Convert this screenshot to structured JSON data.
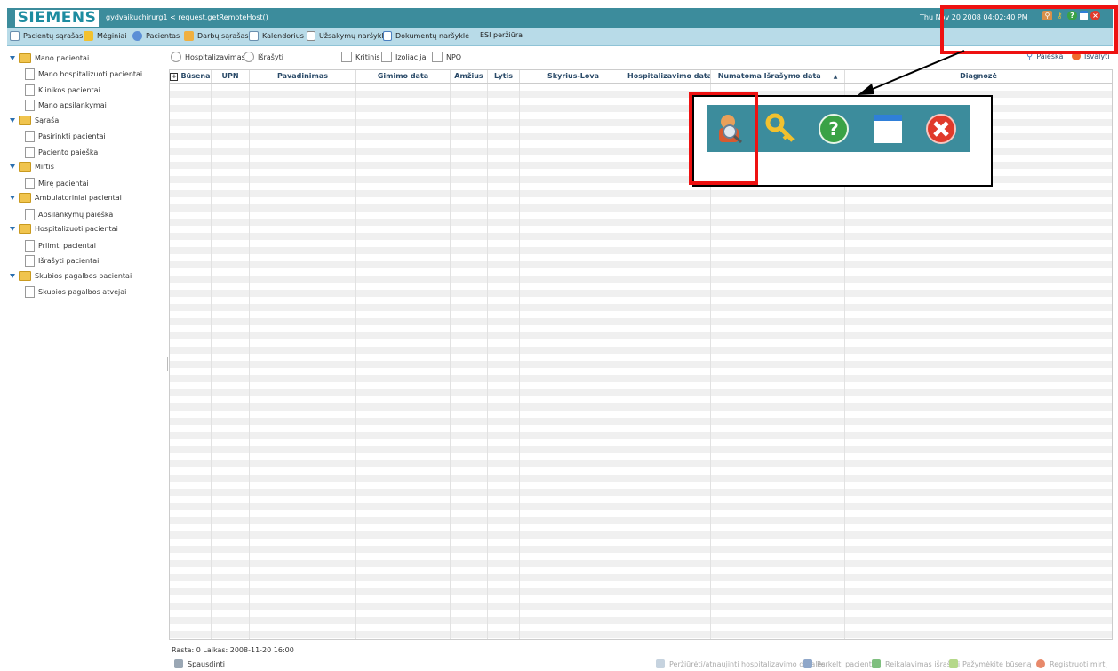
{
  "header": {
    "logo": "SIEMENS",
    "user": "gydvaikuchirurg1  < request.getRemoteHost()",
    "datetime": "Thu Nov 20 2008 04:02:40 PM",
    "icons": [
      "patient-search-icon",
      "key-icon",
      "help-icon",
      "window-icon",
      "close-icon"
    ]
  },
  "menu": {
    "items": [
      {
        "label": "Pacientų sąrašas",
        "icon": "grid-list-icon"
      },
      {
        "label": "Mėginiai",
        "icon": "sample-icon"
      },
      {
        "label": "Pacientas",
        "icon": "patient-icon"
      },
      {
        "label": "Darbų sąrašas",
        "icon": "worklist-icon"
      },
      {
        "label": "Kalendorius",
        "icon": "calendar-icon"
      },
      {
        "label": "Užsakymų naršyklė",
        "icon": "orders-icon"
      },
      {
        "label": "Dokumentų naršyklė",
        "icon": "documents-icon"
      },
      {
        "label": "ESI peržiūra",
        "icon": ""
      }
    ]
  },
  "sidebar": {
    "items": [
      {
        "label": "Mano pacientai",
        "type": "folder"
      },
      {
        "label": "Mano hospitalizuoti pacientai",
        "type": "doc"
      },
      {
        "label": "Klinikos pacientai",
        "type": "doc"
      },
      {
        "label": "Mano apsilankymai",
        "type": "doc"
      },
      {
        "label": "Sąrašai",
        "type": "folder"
      },
      {
        "label": "Pasirinkti pacientai",
        "type": "doc"
      },
      {
        "label": "Paciento paieška",
        "type": "doc"
      },
      {
        "label": "Mirtis",
        "type": "folder"
      },
      {
        "label": "Mirę pacientai",
        "type": "doc"
      },
      {
        "label": "Ambulatoriniai pacientai",
        "type": "folder"
      },
      {
        "label": "Apsilankymų paieška",
        "type": "doc"
      },
      {
        "label": "Hospitalizuoti pacientai",
        "type": "folder"
      },
      {
        "label": "Priimti pacientai",
        "type": "doc"
      },
      {
        "label": "Išrašyti pacientai",
        "type": "doc"
      },
      {
        "label": "Skubios pagalbos pacientai",
        "type": "folder"
      },
      {
        "label": "Skubios pagalbos atvejai",
        "type": "doc"
      }
    ]
  },
  "filters": {
    "radio_hospitalized": "Hospitalizavimas",
    "radio_discharged": "Išrašyti",
    "check_critical": "Kritinis",
    "check_isolation": "Izoliacija",
    "check_npo": "NPO",
    "search_label": "Paieška",
    "clear_label": "Išvalyti"
  },
  "table": {
    "columns": [
      "Būsena",
      "UPN",
      "Pavadinimas",
      "Gimimo data",
      "Amžius",
      "Lytis",
      "Skyrius-Lova",
      "Hospitalizavimo data:",
      "Numatoma Išrašymo data",
      "Diagnozė"
    ],
    "rows": []
  },
  "status": {
    "text": "Rasta: 0  Laikas: 2008-11-20 16:00"
  },
  "bottom": {
    "print_label": "Spausdinti",
    "actions": [
      "Peržiūrėti/atnaujinti hospitalizavimo detales",
      "Perkelti pacientą",
      "Reikalavimas išrašyti",
      "Pažymėkite būseną",
      "Registruoti mirtį"
    ]
  },
  "colors": {
    "header_bg": "#3c8c9c",
    "menu_bg": "#b8dbe8",
    "highlight": "#ee1111"
  }
}
